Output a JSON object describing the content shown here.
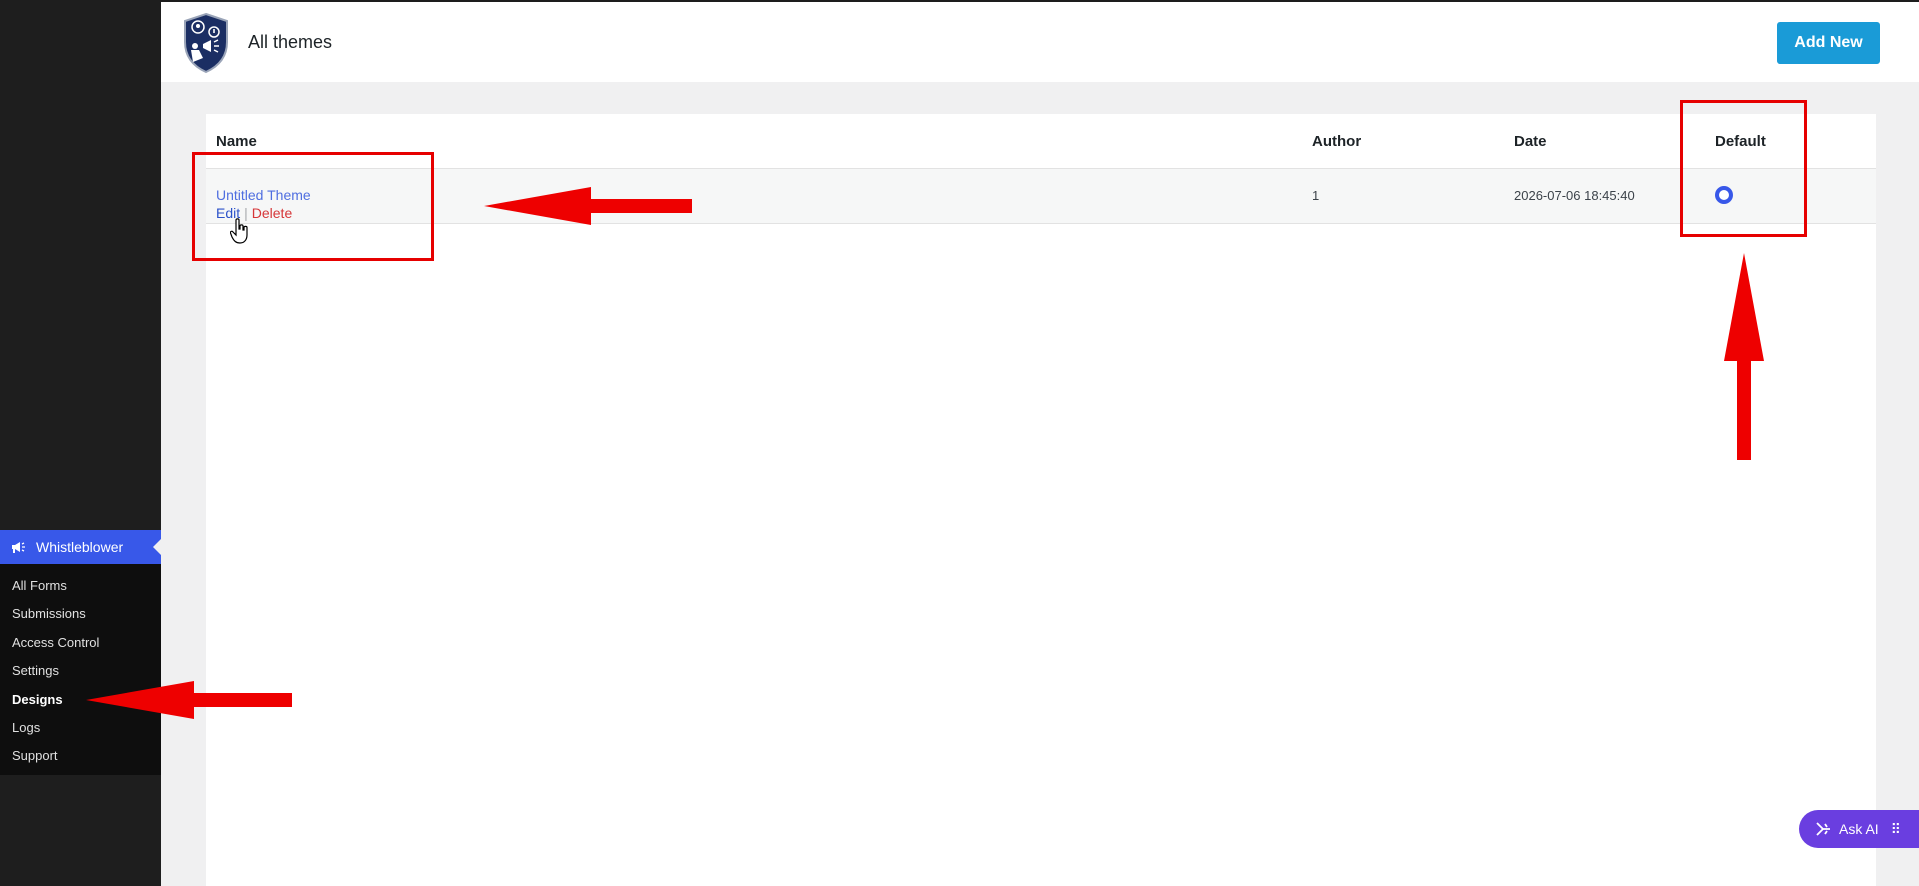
{
  "sidebar": {
    "plugin_title": "Whistleblower",
    "submenu": [
      {
        "label": "All Forms"
      },
      {
        "label": "Submissions"
      },
      {
        "label": "Access Control"
      },
      {
        "label": "Settings"
      },
      {
        "label": "Designs",
        "current": true
      },
      {
        "label": "Logs"
      },
      {
        "label": "Support"
      }
    ]
  },
  "header": {
    "title": "All themes",
    "add_new_label": "Add New"
  },
  "table": {
    "columns": [
      "Name",
      "Author",
      "Date",
      "Default"
    ],
    "rows": [
      {
        "name": "Untitled Theme",
        "edit_label": "Edit",
        "separator": "|",
        "delete_label": "Delete",
        "author": "1",
        "date": "2026-07-06 18:45:40",
        "default_selected": true
      }
    ]
  },
  "ask_ai": {
    "label": "Ask AI",
    "handle": "⠿"
  },
  "colors": {
    "accent": "#3858e9",
    "add_new": "#1a9bd7",
    "annotation": "#e60000",
    "ask_ai": "#6a3ee0"
  }
}
